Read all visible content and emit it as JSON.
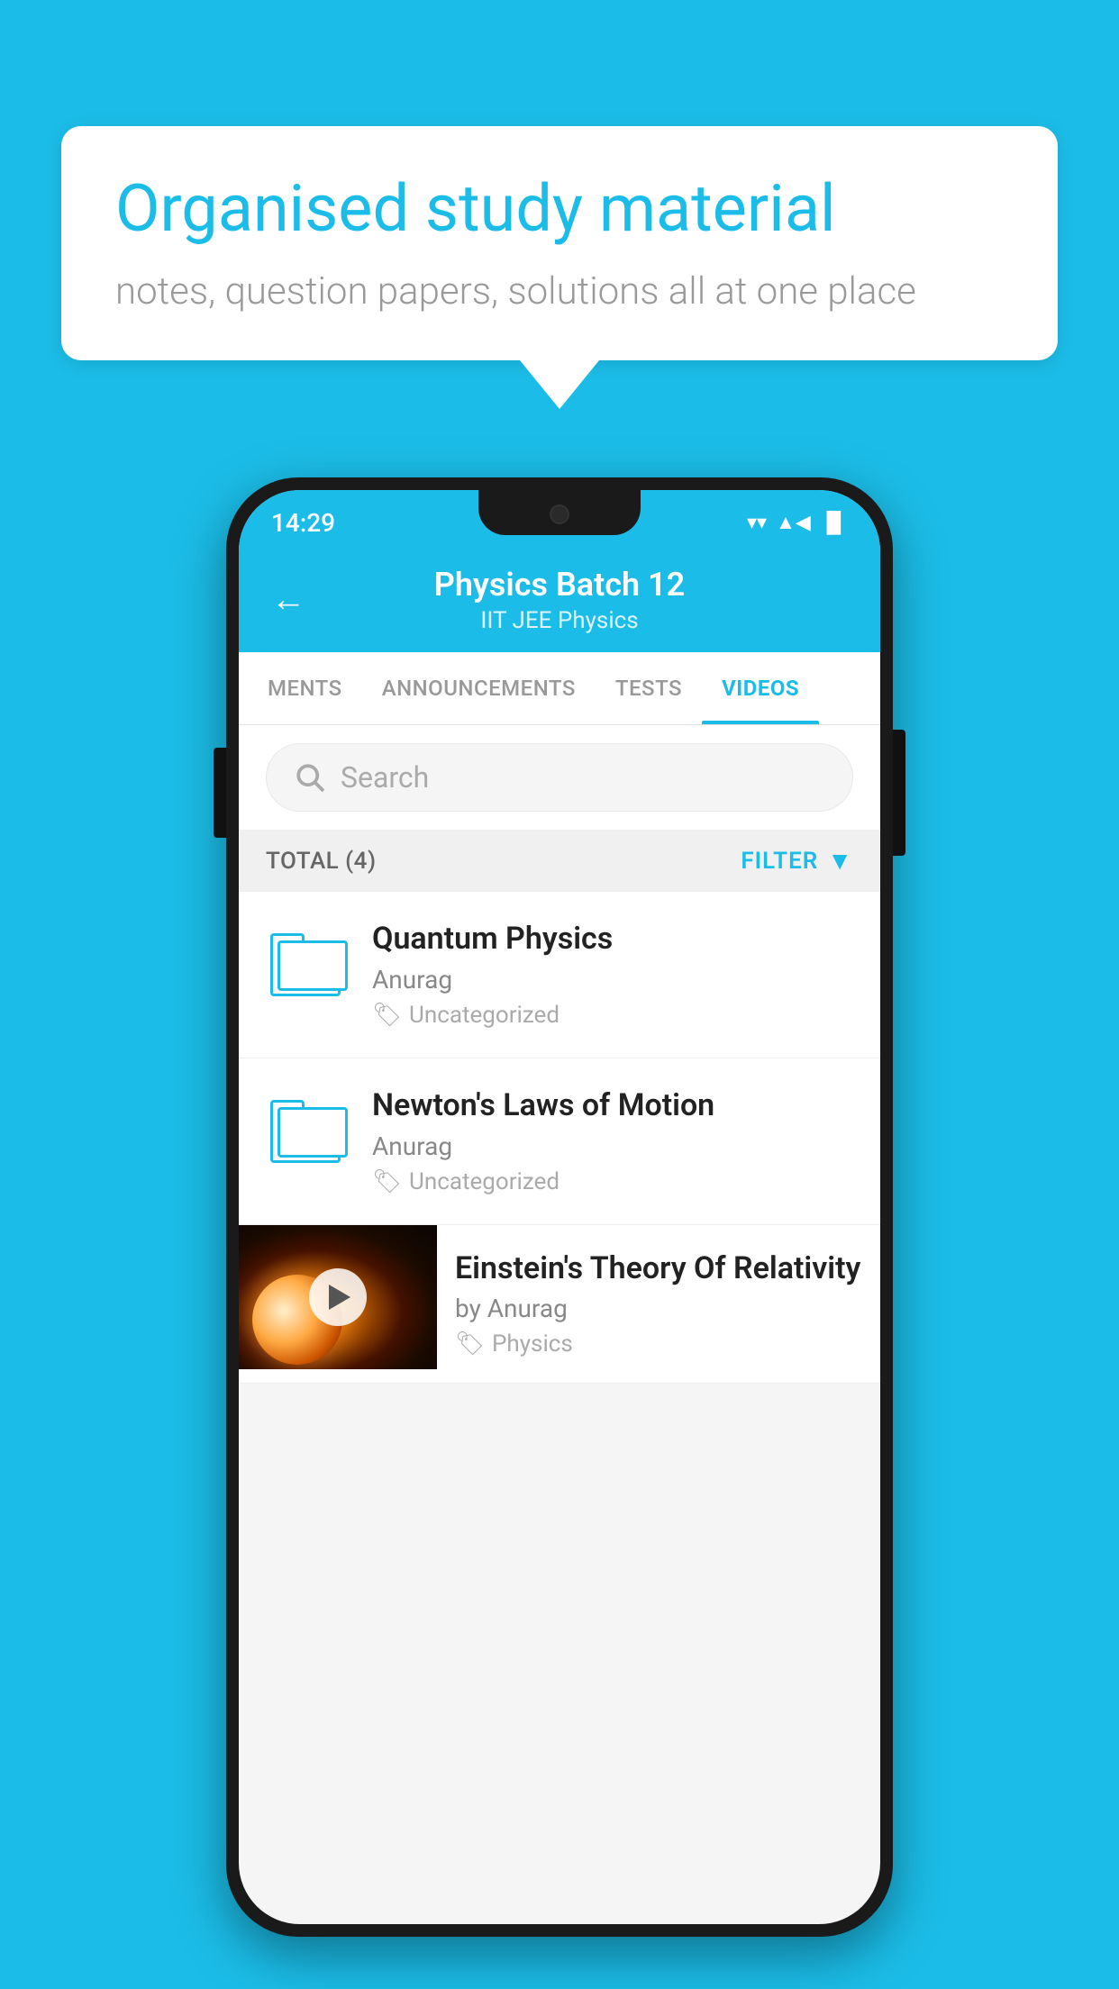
{
  "background_color": "#1bbde8",
  "speech_bubble": {
    "heading": "Organised study material",
    "subtext": "notes, question papers, solutions all at one place"
  },
  "status_bar": {
    "time": "14:29",
    "wifi": "▼",
    "signal": "▲",
    "battery": "▐"
  },
  "app_header": {
    "back_label": "←",
    "title": "Physics Batch 12",
    "subtitle_tags": "IIT JEE   Physics"
  },
  "tabs": [
    {
      "label": "MENTS",
      "active": false
    },
    {
      "label": "ANNOUNCEMENTS",
      "active": false
    },
    {
      "label": "TESTS",
      "active": false
    },
    {
      "label": "VIDEOS",
      "active": true
    }
  ],
  "search": {
    "placeholder": "Search"
  },
  "filter_bar": {
    "total_label": "TOTAL (4)",
    "filter_label": "FILTER"
  },
  "video_items": [
    {
      "id": 1,
      "title": "Quantum Physics",
      "author": "Anurag",
      "tag": "Uncategorized",
      "has_thumb": false
    },
    {
      "id": 2,
      "title": "Newton's Laws of Motion",
      "author": "Anurag",
      "tag": "Uncategorized",
      "has_thumb": false
    },
    {
      "id": 3,
      "title": "Einstein's Theory Of Relativity",
      "author": "by Anurag",
      "tag": "Physics",
      "has_thumb": true
    }
  ]
}
